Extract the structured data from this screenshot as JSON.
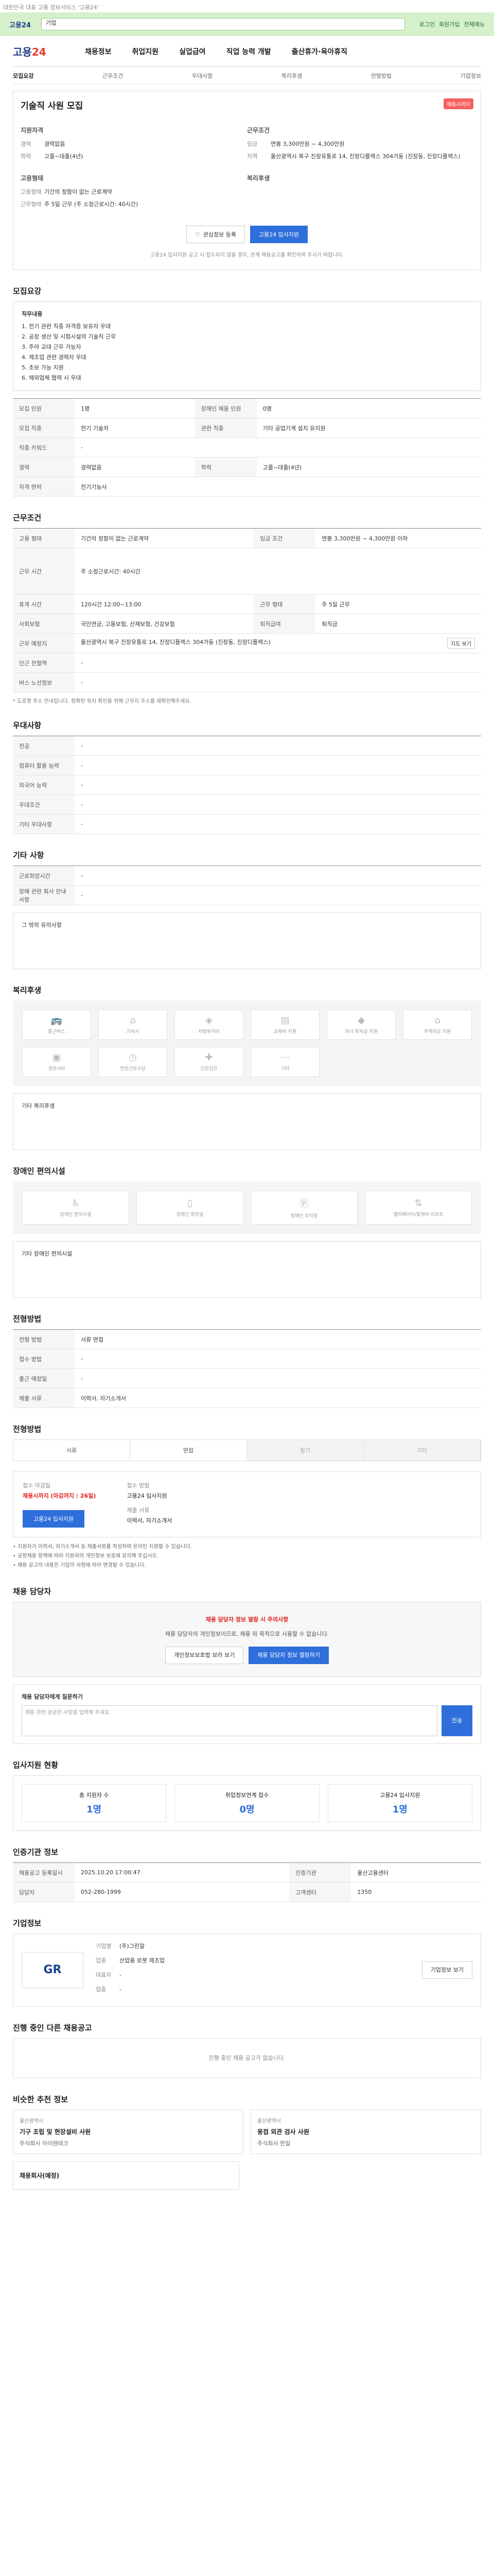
{
  "topnote": "대한민국 대표 고용 정보서비스 '고용24'",
  "search": {
    "logo": "고용24",
    "value": "기업",
    "placeholder": "검색어를 입력하세요",
    "links": [
      "로그인",
      "회원가입",
      "전체메뉴"
    ]
  },
  "gnb": {
    "logo_a": "고용",
    "logo_b": "24",
    "items": [
      "채용정보",
      "취업지원",
      "실업급여",
      "직업 능력 개발",
      "출산휴가·육아휴직"
    ]
  },
  "tabs": [
    "모집요강",
    "근무조건",
    "우대사항",
    "복리후생",
    "전형방법",
    "기업정보"
  ],
  "hero": {
    "title": "기술직 사원 모집",
    "badge": "채용시까지",
    "left_title": "지원자격",
    "left": [
      {
        "k": "경력",
        "v": "경력없음"
      },
      {
        "k": "학력",
        "v": "고졸~대졸(4년)"
      }
    ],
    "right_title": "근무조건",
    "right": [
      {
        "k": "임금",
        "v": "연봉 3,300만원 ~ 4,300만원"
      },
      {
        "k": "지역",
        "v": "울산광역시 북구 진장유통로 14, 진장디플렉스 304가동 (진장동, 진장디플렉스)"
      }
    ],
    "left2_title": "고용형태",
    "left2": [
      {
        "k": "고용형태",
        "v": "기간의 정함이 없는 근로계약"
      },
      {
        "k": "근무형태",
        "v": "주 5일 근무 (주 소정근로시간: 40시간)"
      }
    ],
    "right2_title": "복리후생",
    "btn_save": "관심정보 등록",
    "btn_apply": "고용24 입사지원",
    "note": "고용24 입사지원 공고 시 접수되지 않을 경우, 관계 채용공고를 확인하여 주시기 바랍니다."
  },
  "sec1": {
    "title": "모집요강",
    "duties_title": "직무내용",
    "duties": [
      "1. 전기 관련 직종 자격증 보유자 우대",
      "2. 공장 생산 및 시험시설의 기술직 근무",
      "3. 주야 교대 근무 가능자",
      "4. 제조업 관련 경력자 우대",
      "5. 초보 가능 지원",
      "6. 해외업체 협력 시 우대"
    ],
    "rows": [
      [
        "모집 인원",
        "1명",
        "장애인 채용 인원",
        "0명"
      ],
      [
        "모집 직종",
        "전기 기술자",
        "관련 직종",
        "기타 공업기계 설치 유지원"
      ],
      [
        "직종 키워드",
        "-",
        "",
        ""
      ],
      [
        "경력",
        "경력없음",
        "학력",
        "고졸~대졸(4년)"
      ],
      [
        "자격 면허",
        "전기기능사",
        "",
        ""
      ]
    ]
  },
  "sec2": {
    "title": "근무조건",
    "rows": [
      [
        "고용 형태",
        "기간의 정함이 없는 근로계약",
        "임금 조건",
        "연봉 3,300만원 ~ 4,300만원 이하"
      ],
      [
        "근무 시간",
        "주 소정근로시간: 40시간",
        "",
        ""
      ],
      [
        "휴게 시간",
        "120시간 12:00~13:00",
        "근무 형태",
        "주 5일 근무"
      ],
      [
        "사회보험",
        "국민연금, 고용보험, 산재보험, 건강보험",
        "퇴직급여",
        "퇴직금"
      ],
      [
        "근무 예정지",
        "울산광역시 북구 진장유통로 14, 진장디플렉스 304가동 (진장동, 진장디플렉스)",
        "",
        ""
      ],
      [
        "인근 전철역",
        "-",
        "",
        ""
      ],
      [
        "버스 노선정보",
        "-",
        "",
        ""
      ]
    ],
    "map_btn": "지도 보기",
    "note": "* 도로명 주소 안내입니다. 정확한 위치 확인을 위해 근무지 주소를 재확인해주세요."
  },
  "sec3": {
    "title": "우대사항",
    "rows": [
      [
        "전공",
        "-"
      ],
      [
        "컴퓨터 활용 능력",
        "-"
      ],
      [
        "외국어 능력",
        "-"
      ],
      [
        "우대조건",
        "-"
      ],
      [
        "기타 우대사항",
        "-"
      ]
    ]
  },
  "sec4": {
    "title": "기타 사항",
    "rows": [
      [
        "근로희망시간",
        "-"
      ],
      [
        "장애 관련 회사 안내사항",
        "-"
      ]
    ],
    "detail_title": "그 밖의 유의사항"
  },
  "sec5": {
    "title": "복리후생",
    "items": [
      "통근버스",
      "기숙사",
      "차량유지비",
      "교육비 지원",
      "자녀 학자금 지원",
      "주택자금 지원",
      "경조사비",
      "연장근로수당",
      "건강검진",
      "기타"
    ],
    "extra": "기타 복리후생"
  },
  "sec6": {
    "title": "장애인 편의시설",
    "items": [
      "장애인 편의시설",
      "장애인 화장실",
      "장애인 주차장",
      "엘리베이터/휠체어 리프트"
    ],
    "extra": "기타 장애인 편의시설"
  },
  "sec7": {
    "title": "전형방법",
    "rows": [
      [
        "전형 방법",
        "서류 면접"
      ],
      [
        "접수 방법",
        "-"
      ],
      [
        "출근 예정일",
        "-"
      ],
      [
        "제출 서류",
        "이력서, 자기소개서"
      ]
    ]
  },
  "sec8": {
    "title": "전형방법",
    "methods": [
      "서류",
      "면접",
      "필기",
      "기타"
    ]
  },
  "apply": {
    "deadline_label": "접수 마감일",
    "deadline": "채용시까지 (마감까지 : 26일)",
    "method_label": "접수 방법",
    "method": "고용24 입사지원",
    "docs_label": "제출 서류",
    "docs": "이력서, 자기소개서",
    "btn": "고용24 입사지원",
    "notices": [
      "• 지원자가 이력서, 자기소개서 등 제출서류를 작성하여 온라인 지원할 수 있습니다.",
      "• 공정채용 정책에 따라 지원자의 개인정보 보호에 유의해 주십시오.",
      "• 채용 공고의 내용은 기업의 사정에 따라 변경될 수 있습니다."
    ]
  },
  "contact": {
    "title": "채용 담당자",
    "alert": "채용 담당자 정보 열람 시 주의사항",
    "alert_text": "채용 담당자의 개인정보이므로, 채용 외 목적으로 사용할 수 없습니다.",
    "btn_a": "개인정보보호법 보러 보기",
    "btn_b": "채용 담당자 정보 열람하기",
    "inquiry_title": "채용 담당자에게 질문하기",
    "inquiry_placeholder": "채용 관련 궁금한 사항을 입력해 주세요.",
    "send": "전송"
  },
  "stats": {
    "title": "입사지원 현황",
    "items": [
      {
        "k": "총 지원자 수",
        "v": "1명"
      },
      {
        "k": "취업정보연계 접수",
        "v": "0명"
      },
      {
        "k": "고용24 입사지원",
        "v": "1명"
      }
    ]
  },
  "manage": {
    "title": "인증기관 정보",
    "rows": [
      [
        "채용공고 등록일시",
        "2025.10.20 17:00:47",
        "인증기관",
        "울산고용센터"
      ],
      [
        "담당자",
        "052-280-1999",
        "고객센터",
        "1350"
      ]
    ]
  },
  "company": {
    "title": "기업정보",
    "logo": "GR",
    "rows": [
      [
        "기업명",
        "(주)그린알"
      ],
      [
        "업종",
        "산업용 로봇 제조업"
      ],
      [
        "대표자",
        "-"
      ],
      [
        "업종",
        "-"
      ]
    ],
    "btn": "기업정보 보기"
  },
  "other": {
    "title": "진행 중인 다른 채용공고",
    "empty": "진행 중인 채용 공고가 없습니다."
  },
  "rec": {
    "title": "비슷한 추천 정보",
    "items": [
      {
        "tag": "울산광역시",
        "title": "기구 조립 및 현장설비 사원",
        "sub": "주식회사 아이엔테크"
      },
      {
        "tag": "울산광역시",
        "title": "용접 외관 검사 사원",
        "sub": "주식회사 한일"
      }
    ],
    "extra_title": "채용회사(예정)"
  }
}
